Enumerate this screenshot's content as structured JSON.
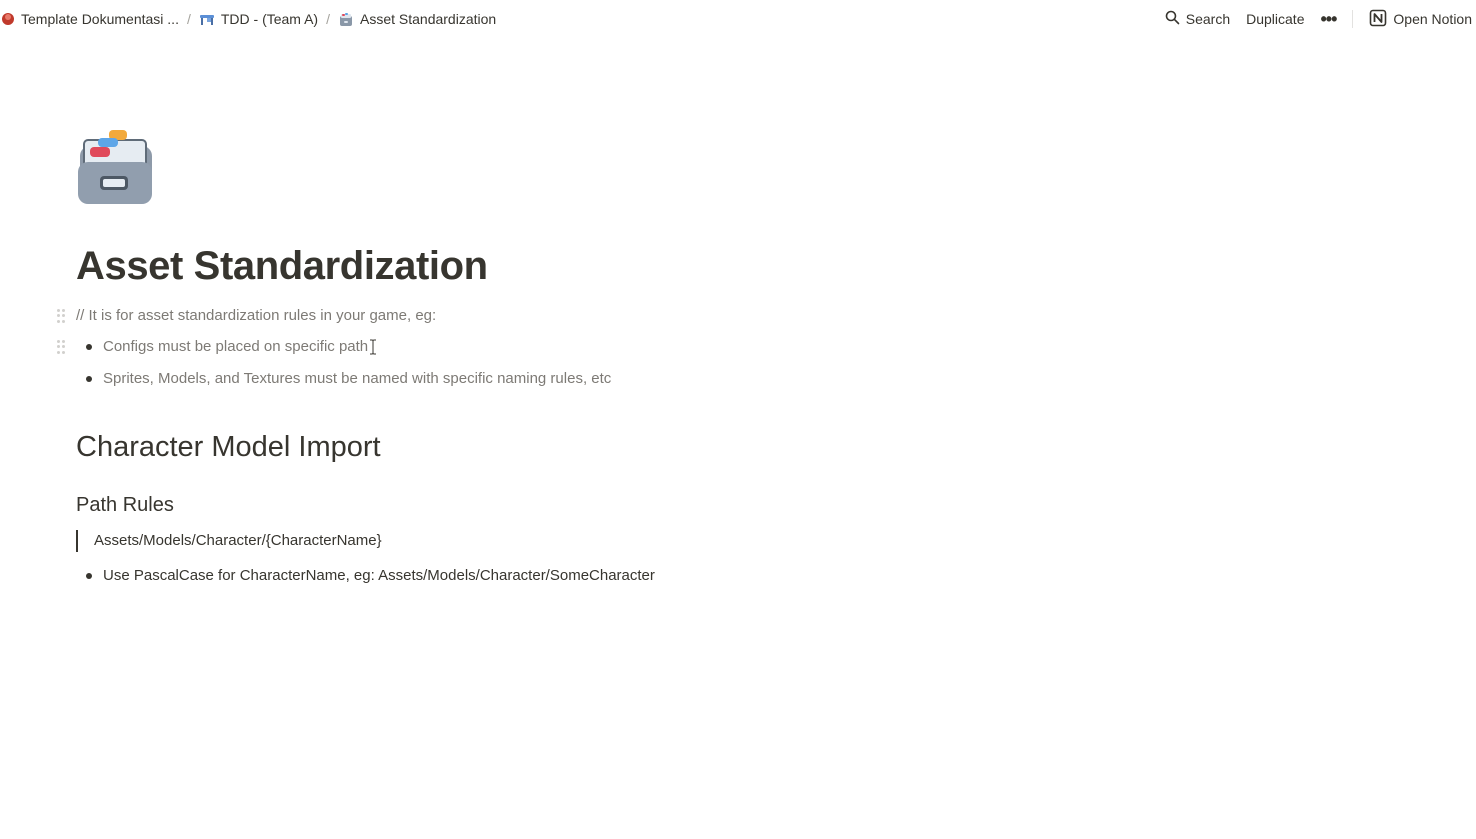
{
  "topbar": {
    "breadcrumb": [
      {
        "label": "Template Dokumentasi ...",
        "icon": "avatar-icon"
      },
      {
        "label": "TDD - (Team A)",
        "icon": "desk-icon"
      },
      {
        "label": "Asset Standardization",
        "icon": "card-file-box-icon"
      }
    ],
    "separator": "/",
    "actions": {
      "search_label": "Search",
      "duplicate_label": "Duplicate",
      "more_label": "•••",
      "open_notion_label": "Open Notion"
    }
  },
  "page": {
    "icon": "card-file-box-icon",
    "title": "Asset Standardization",
    "intro": "// It is for asset standardization rules in your game, eg:",
    "intro_bullets": [
      "Configs must be placed on specific path",
      "Sprites, Models, and Textures must be named with specific naming rules, etc"
    ],
    "section_heading": "Character Model Import",
    "subsection_heading": "Path Rules",
    "quote": "Assets/Models/Character/{CharacterName}",
    "rule_bullets": [
      "Use PascalCase for CharacterName, eg: Assets/Models/Character/SomeCharacter"
    ]
  },
  "colors": {
    "text": "#37352f",
    "muted": "#7d7a75",
    "background": "#ffffff"
  }
}
